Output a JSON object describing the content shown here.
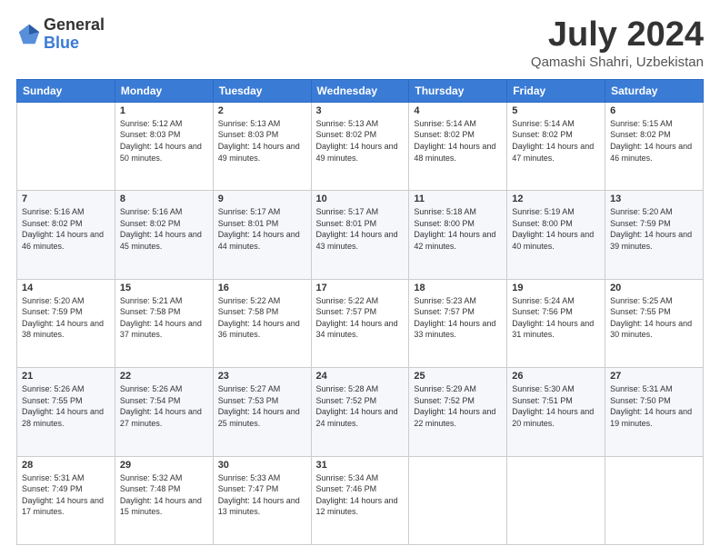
{
  "logo": {
    "general": "General",
    "blue": "Blue"
  },
  "title": "July 2024",
  "location": "Qamashi Shahri, Uzbekistan",
  "days": [
    "Sunday",
    "Monday",
    "Tuesday",
    "Wednesday",
    "Thursday",
    "Friday",
    "Saturday"
  ],
  "weeks": [
    [
      {
        "day": "",
        "sunrise": "",
        "sunset": "",
        "daylight": ""
      },
      {
        "day": "1",
        "sunrise": "Sunrise: 5:12 AM",
        "sunset": "Sunset: 8:03 PM",
        "daylight": "Daylight: 14 hours and 50 minutes."
      },
      {
        "day": "2",
        "sunrise": "Sunrise: 5:13 AM",
        "sunset": "Sunset: 8:03 PM",
        "daylight": "Daylight: 14 hours and 49 minutes."
      },
      {
        "day": "3",
        "sunrise": "Sunrise: 5:13 AM",
        "sunset": "Sunset: 8:02 PM",
        "daylight": "Daylight: 14 hours and 49 minutes."
      },
      {
        "day": "4",
        "sunrise": "Sunrise: 5:14 AM",
        "sunset": "Sunset: 8:02 PM",
        "daylight": "Daylight: 14 hours and 48 minutes."
      },
      {
        "day": "5",
        "sunrise": "Sunrise: 5:14 AM",
        "sunset": "Sunset: 8:02 PM",
        "daylight": "Daylight: 14 hours and 47 minutes."
      },
      {
        "day": "6",
        "sunrise": "Sunrise: 5:15 AM",
        "sunset": "Sunset: 8:02 PM",
        "daylight": "Daylight: 14 hours and 46 minutes."
      }
    ],
    [
      {
        "day": "7",
        "sunrise": "Sunrise: 5:16 AM",
        "sunset": "Sunset: 8:02 PM",
        "daylight": "Daylight: 14 hours and 46 minutes."
      },
      {
        "day": "8",
        "sunrise": "Sunrise: 5:16 AM",
        "sunset": "Sunset: 8:02 PM",
        "daylight": "Daylight: 14 hours and 45 minutes."
      },
      {
        "day": "9",
        "sunrise": "Sunrise: 5:17 AM",
        "sunset": "Sunset: 8:01 PM",
        "daylight": "Daylight: 14 hours and 44 minutes."
      },
      {
        "day": "10",
        "sunrise": "Sunrise: 5:17 AM",
        "sunset": "Sunset: 8:01 PM",
        "daylight": "Daylight: 14 hours and 43 minutes."
      },
      {
        "day": "11",
        "sunrise": "Sunrise: 5:18 AM",
        "sunset": "Sunset: 8:00 PM",
        "daylight": "Daylight: 14 hours and 42 minutes."
      },
      {
        "day": "12",
        "sunrise": "Sunrise: 5:19 AM",
        "sunset": "Sunset: 8:00 PM",
        "daylight": "Daylight: 14 hours and 40 minutes."
      },
      {
        "day": "13",
        "sunrise": "Sunrise: 5:20 AM",
        "sunset": "Sunset: 7:59 PM",
        "daylight": "Daylight: 14 hours and 39 minutes."
      }
    ],
    [
      {
        "day": "14",
        "sunrise": "Sunrise: 5:20 AM",
        "sunset": "Sunset: 7:59 PM",
        "daylight": "Daylight: 14 hours and 38 minutes."
      },
      {
        "day": "15",
        "sunrise": "Sunrise: 5:21 AM",
        "sunset": "Sunset: 7:58 PM",
        "daylight": "Daylight: 14 hours and 37 minutes."
      },
      {
        "day": "16",
        "sunrise": "Sunrise: 5:22 AM",
        "sunset": "Sunset: 7:58 PM",
        "daylight": "Daylight: 14 hours and 36 minutes."
      },
      {
        "day": "17",
        "sunrise": "Sunrise: 5:22 AM",
        "sunset": "Sunset: 7:57 PM",
        "daylight": "Daylight: 14 hours and 34 minutes."
      },
      {
        "day": "18",
        "sunrise": "Sunrise: 5:23 AM",
        "sunset": "Sunset: 7:57 PM",
        "daylight": "Daylight: 14 hours and 33 minutes."
      },
      {
        "day": "19",
        "sunrise": "Sunrise: 5:24 AM",
        "sunset": "Sunset: 7:56 PM",
        "daylight": "Daylight: 14 hours and 31 minutes."
      },
      {
        "day": "20",
        "sunrise": "Sunrise: 5:25 AM",
        "sunset": "Sunset: 7:55 PM",
        "daylight": "Daylight: 14 hours and 30 minutes."
      }
    ],
    [
      {
        "day": "21",
        "sunrise": "Sunrise: 5:26 AM",
        "sunset": "Sunset: 7:55 PM",
        "daylight": "Daylight: 14 hours and 28 minutes."
      },
      {
        "day": "22",
        "sunrise": "Sunrise: 5:26 AM",
        "sunset": "Sunset: 7:54 PM",
        "daylight": "Daylight: 14 hours and 27 minutes."
      },
      {
        "day": "23",
        "sunrise": "Sunrise: 5:27 AM",
        "sunset": "Sunset: 7:53 PM",
        "daylight": "Daylight: 14 hours and 25 minutes."
      },
      {
        "day": "24",
        "sunrise": "Sunrise: 5:28 AM",
        "sunset": "Sunset: 7:52 PM",
        "daylight": "Daylight: 14 hours and 24 minutes."
      },
      {
        "day": "25",
        "sunrise": "Sunrise: 5:29 AM",
        "sunset": "Sunset: 7:52 PM",
        "daylight": "Daylight: 14 hours and 22 minutes."
      },
      {
        "day": "26",
        "sunrise": "Sunrise: 5:30 AM",
        "sunset": "Sunset: 7:51 PM",
        "daylight": "Daylight: 14 hours and 20 minutes."
      },
      {
        "day": "27",
        "sunrise": "Sunrise: 5:31 AM",
        "sunset": "Sunset: 7:50 PM",
        "daylight": "Daylight: 14 hours and 19 minutes."
      }
    ],
    [
      {
        "day": "28",
        "sunrise": "Sunrise: 5:31 AM",
        "sunset": "Sunset: 7:49 PM",
        "daylight": "Daylight: 14 hours and 17 minutes."
      },
      {
        "day": "29",
        "sunrise": "Sunrise: 5:32 AM",
        "sunset": "Sunset: 7:48 PM",
        "daylight": "Daylight: 14 hours and 15 minutes."
      },
      {
        "day": "30",
        "sunrise": "Sunrise: 5:33 AM",
        "sunset": "Sunset: 7:47 PM",
        "daylight": "Daylight: 14 hours and 13 minutes."
      },
      {
        "day": "31",
        "sunrise": "Sunrise: 5:34 AM",
        "sunset": "Sunset: 7:46 PM",
        "daylight": "Daylight: 14 hours and 12 minutes."
      },
      {
        "day": "",
        "sunrise": "",
        "sunset": "",
        "daylight": ""
      },
      {
        "day": "",
        "sunrise": "",
        "sunset": "",
        "daylight": ""
      },
      {
        "day": "",
        "sunrise": "",
        "sunset": "",
        "daylight": ""
      }
    ]
  ]
}
